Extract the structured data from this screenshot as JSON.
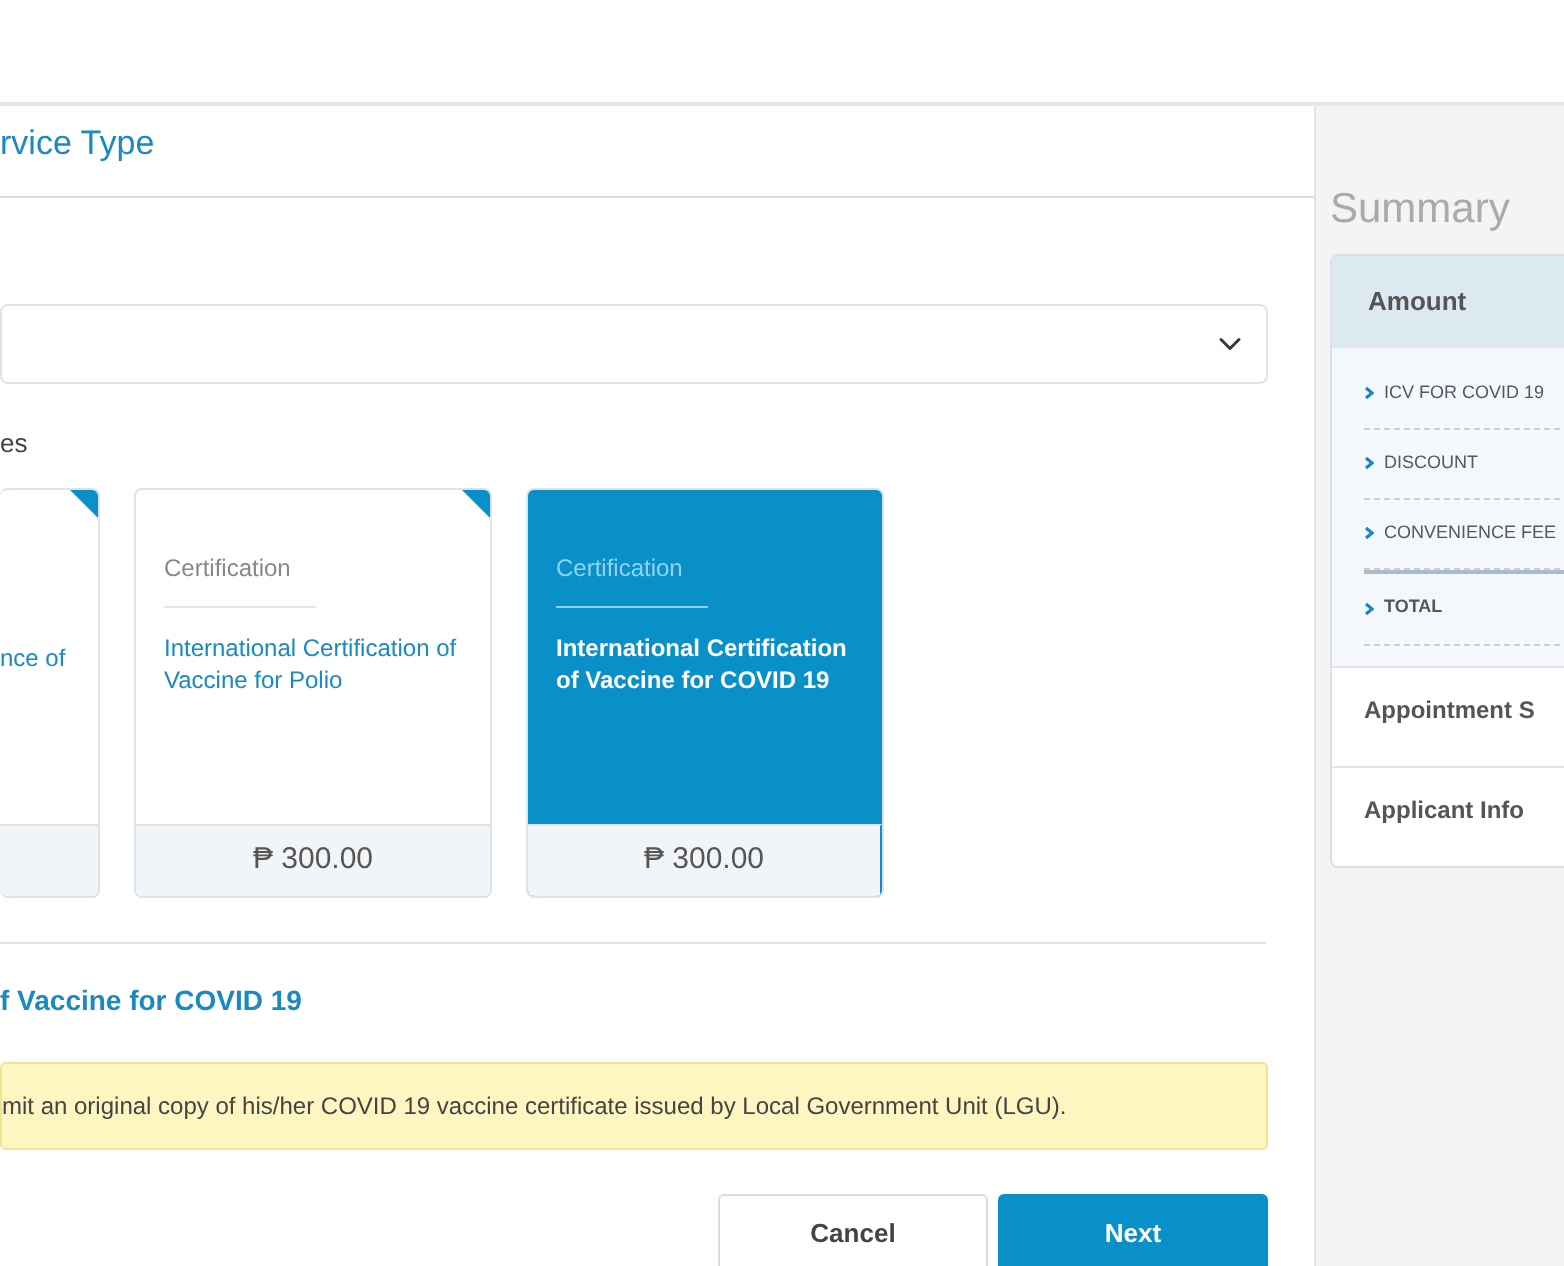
{
  "section_title": "rvice Type",
  "cards_label": "es",
  "cards": [
    {
      "name": "nce of",
      "selected": false
    },
    {
      "category": "Certification",
      "name": "International Certification of Vaccine for Polio",
      "price": "₱ 300.00",
      "selected": false
    },
    {
      "category": "Certification",
      "name": "International Certification of Vaccine for COVID 19",
      "price": "₱ 300.00",
      "selected": true
    }
  ],
  "selected_heading": "f Vaccine for COVID 19",
  "notice": "mit an original copy of his/her COVID 19 vaccine certificate issued by Local Government Unit (LGU).",
  "buttons": [
    {
      "label": "Cancel",
      "kind": "secondary"
    },
    {
      "label": "Next",
      "kind": "primary"
    }
  ],
  "summary": {
    "title": "Summary",
    "amount_header": "Amount",
    "items": [
      {
        "label": "ICV FOR COVID 19",
        "kind": "line"
      },
      {
        "label": "DISCOUNT",
        "kind": "line"
      },
      {
        "label": "CONVENIENCE FEE",
        "kind": "line"
      },
      {
        "label": "TOTAL",
        "kind": "total"
      }
    ],
    "sections": [
      "Appointment S",
      "Applicant Info"
    ]
  }
}
